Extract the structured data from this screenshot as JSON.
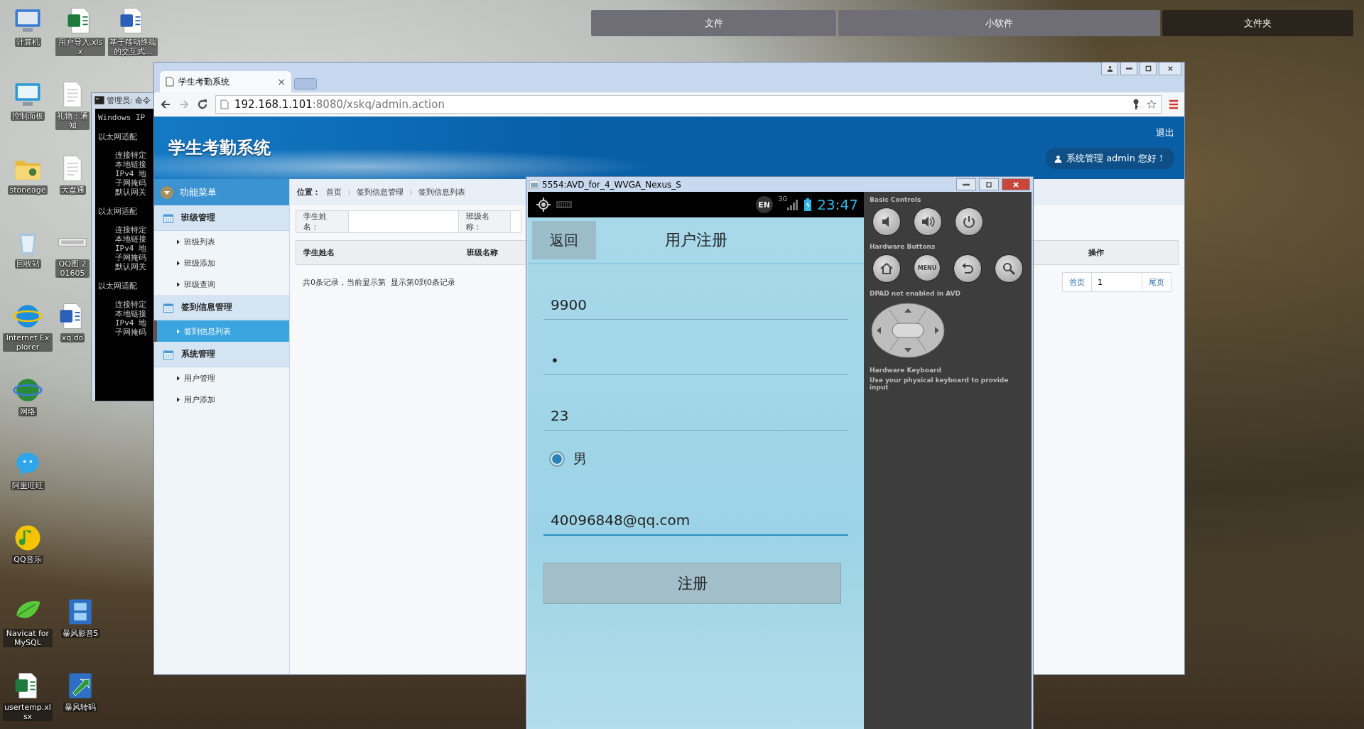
{
  "dock": [
    {
      "label": "文件"
    },
    {
      "label": "小软件"
    },
    {
      "label": "文件夹"
    }
  ],
  "desktop_icons": [
    {
      "kind": "computer",
      "label": "计算机"
    },
    {
      "kind": "control_panel",
      "label": "控制面板"
    },
    {
      "kind": "folder",
      "label": "stoneage"
    },
    {
      "kind": "recycle",
      "label": "回收站"
    },
    {
      "kind": "browser",
      "label": "Internet Explorer"
    },
    {
      "kind": "network",
      "label": "网络"
    },
    {
      "kind": "chat",
      "label": "阿里旺旺"
    },
    {
      "kind": "music",
      "label": "QQ音乐"
    },
    {
      "kind": "database",
      "label": "Navicat for MySQL"
    },
    {
      "kind": "spreadsheet",
      "label": "usertemp.xlsx"
    },
    {
      "kind": "spreadsheet",
      "label": "用户导入.xlsx"
    },
    {
      "kind": "text",
      "label": "礼物：通知"
    },
    {
      "kind": "text",
      "label": "大盘通"
    },
    {
      "kind": "image",
      "label": "QQ图 201605"
    },
    {
      "kind": "document",
      "label": "xq.do"
    },
    {
      "kind": "video",
      "label": "暴风影音5"
    },
    {
      "kind": "converter",
      "label": "暴风转码"
    },
    {
      "kind": "document",
      "label": "基于移动终端的交互式..."
    }
  ],
  "cmd_window": {
    "title": "管理员: 命令",
    "blocks": [
      {
        "heading": "Windows IP"
      },
      {
        "heading": "以太网适配",
        "lines": [
          "连接特定",
          "本地链接",
          "IPv4 地",
          "子网掩码",
          "默认网关"
        ]
      },
      {
        "heading": "以太网适配",
        "lines": [
          "连接特定",
          "本地链接",
          "IPv4 地",
          "子网掩码",
          "默认网关"
        ]
      },
      {
        "heading": "以太网适配",
        "lines": [
          "连接特定",
          "本地链接",
          "IPv4 地",
          "子网掩码"
        ]
      }
    ]
  },
  "browser": {
    "tab_title": "学生考勤系统",
    "tab_close": "×",
    "url_host": "192.168.1.101",
    "url_path": ":8080/xskq/admin.action"
  },
  "app": {
    "title": "学生考勤系统",
    "logout": "退出",
    "user_badge": "系统管理 admin 您好！",
    "menu_title": "功能菜单",
    "menu": [
      {
        "label": "班级管理",
        "children": [
          {
            "label": "班级列表",
            "selected": false
          },
          {
            "label": "班级添加",
            "selected": false
          },
          {
            "label": "班级查询",
            "selected": false
          }
        ]
      },
      {
        "label": "签到信息管理",
        "children": [
          {
            "label": "签到信息列表",
            "selected": true
          }
        ]
      },
      {
        "label": "系统管理",
        "children": [
          {
            "label": "用户管理",
            "selected": false
          },
          {
            "label": "用户添加",
            "selected": false
          }
        ]
      }
    ],
    "breadcrumb": {
      "label": "位置：",
      "items": [
        "首页",
        "签到信息管理",
        "签到信息列表"
      ]
    },
    "search_labels": [
      "学生姓名：",
      "班级名称："
    ],
    "columns": [
      "学生姓名",
      "班级名称",
      "操作"
    ],
    "summary": "共0条记录，当前显示第  显示第0到0条记录",
    "pager": {
      "first": "首页",
      "page": "1",
      "last": "尾页"
    }
  },
  "emulator": {
    "title": "5554:AVD_for_4_WVGA_Nexus_S",
    "status": {
      "ime": "EN",
      "network": "3G",
      "time": "23:47"
    },
    "screen": {
      "back": "返回",
      "title": "用户注册",
      "fields": [
        {
          "kind": "text",
          "value": "9900",
          "focused": false
        },
        {
          "kind": "text",
          "value": "•",
          "focused": false
        },
        {
          "kind": "text",
          "value": "23",
          "focused": false
        },
        {
          "kind": "radio",
          "label": "男",
          "selected": true
        },
        {
          "kind": "text",
          "value": "40096848@qq.com",
          "focused": true
        }
      ],
      "submit": "注册"
    },
    "panel": {
      "sections": [
        {
          "title": "Basic Controls",
          "buttons": [
            {
              "kind": "volume-down"
            },
            {
              "kind": "volume-up"
            },
            {
              "kind": "power"
            }
          ]
        },
        {
          "title": "Hardware Buttons",
          "buttons": [
            {
              "kind": "home"
            },
            {
              "kind": "menu",
              "label": "MENU"
            },
            {
              "kind": "back"
            },
            {
              "kind": "search"
            }
          ]
        }
      ],
      "dpad_note": "DPAD not enabled in AVD",
      "keyboard_title": "Hardware Keyboard",
      "keyboard_hint": "Use your physical keyboard to provide input"
    }
  }
}
